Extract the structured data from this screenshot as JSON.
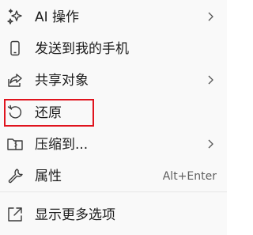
{
  "menu": {
    "items": [
      {
        "label": "AI 操作",
        "icon": "sparkle-icon",
        "has_submenu": true
      },
      {
        "label": "发送到我的手机",
        "icon": "phone-icon",
        "has_submenu": false
      },
      {
        "label": "共享对象",
        "icon": "share-icon",
        "has_submenu": true
      },
      {
        "label": "还原",
        "icon": "restore-icon",
        "has_submenu": false,
        "highlighted": true
      },
      {
        "label": "压缩到...",
        "icon": "zip-folder-icon",
        "has_submenu": true
      },
      {
        "label": "属性",
        "icon": "wrench-icon",
        "shortcut": "Alt+Enter",
        "has_submenu": false
      },
      {
        "label": "显示更多选项",
        "icon": "expand-icon",
        "has_submenu": false
      }
    ]
  },
  "colors": {
    "text": "#1b1b1b",
    "icon": "#444444",
    "shortcut": "#5f5f5f",
    "highlight_border": "#e0141e",
    "background": "#f9f9f9"
  }
}
